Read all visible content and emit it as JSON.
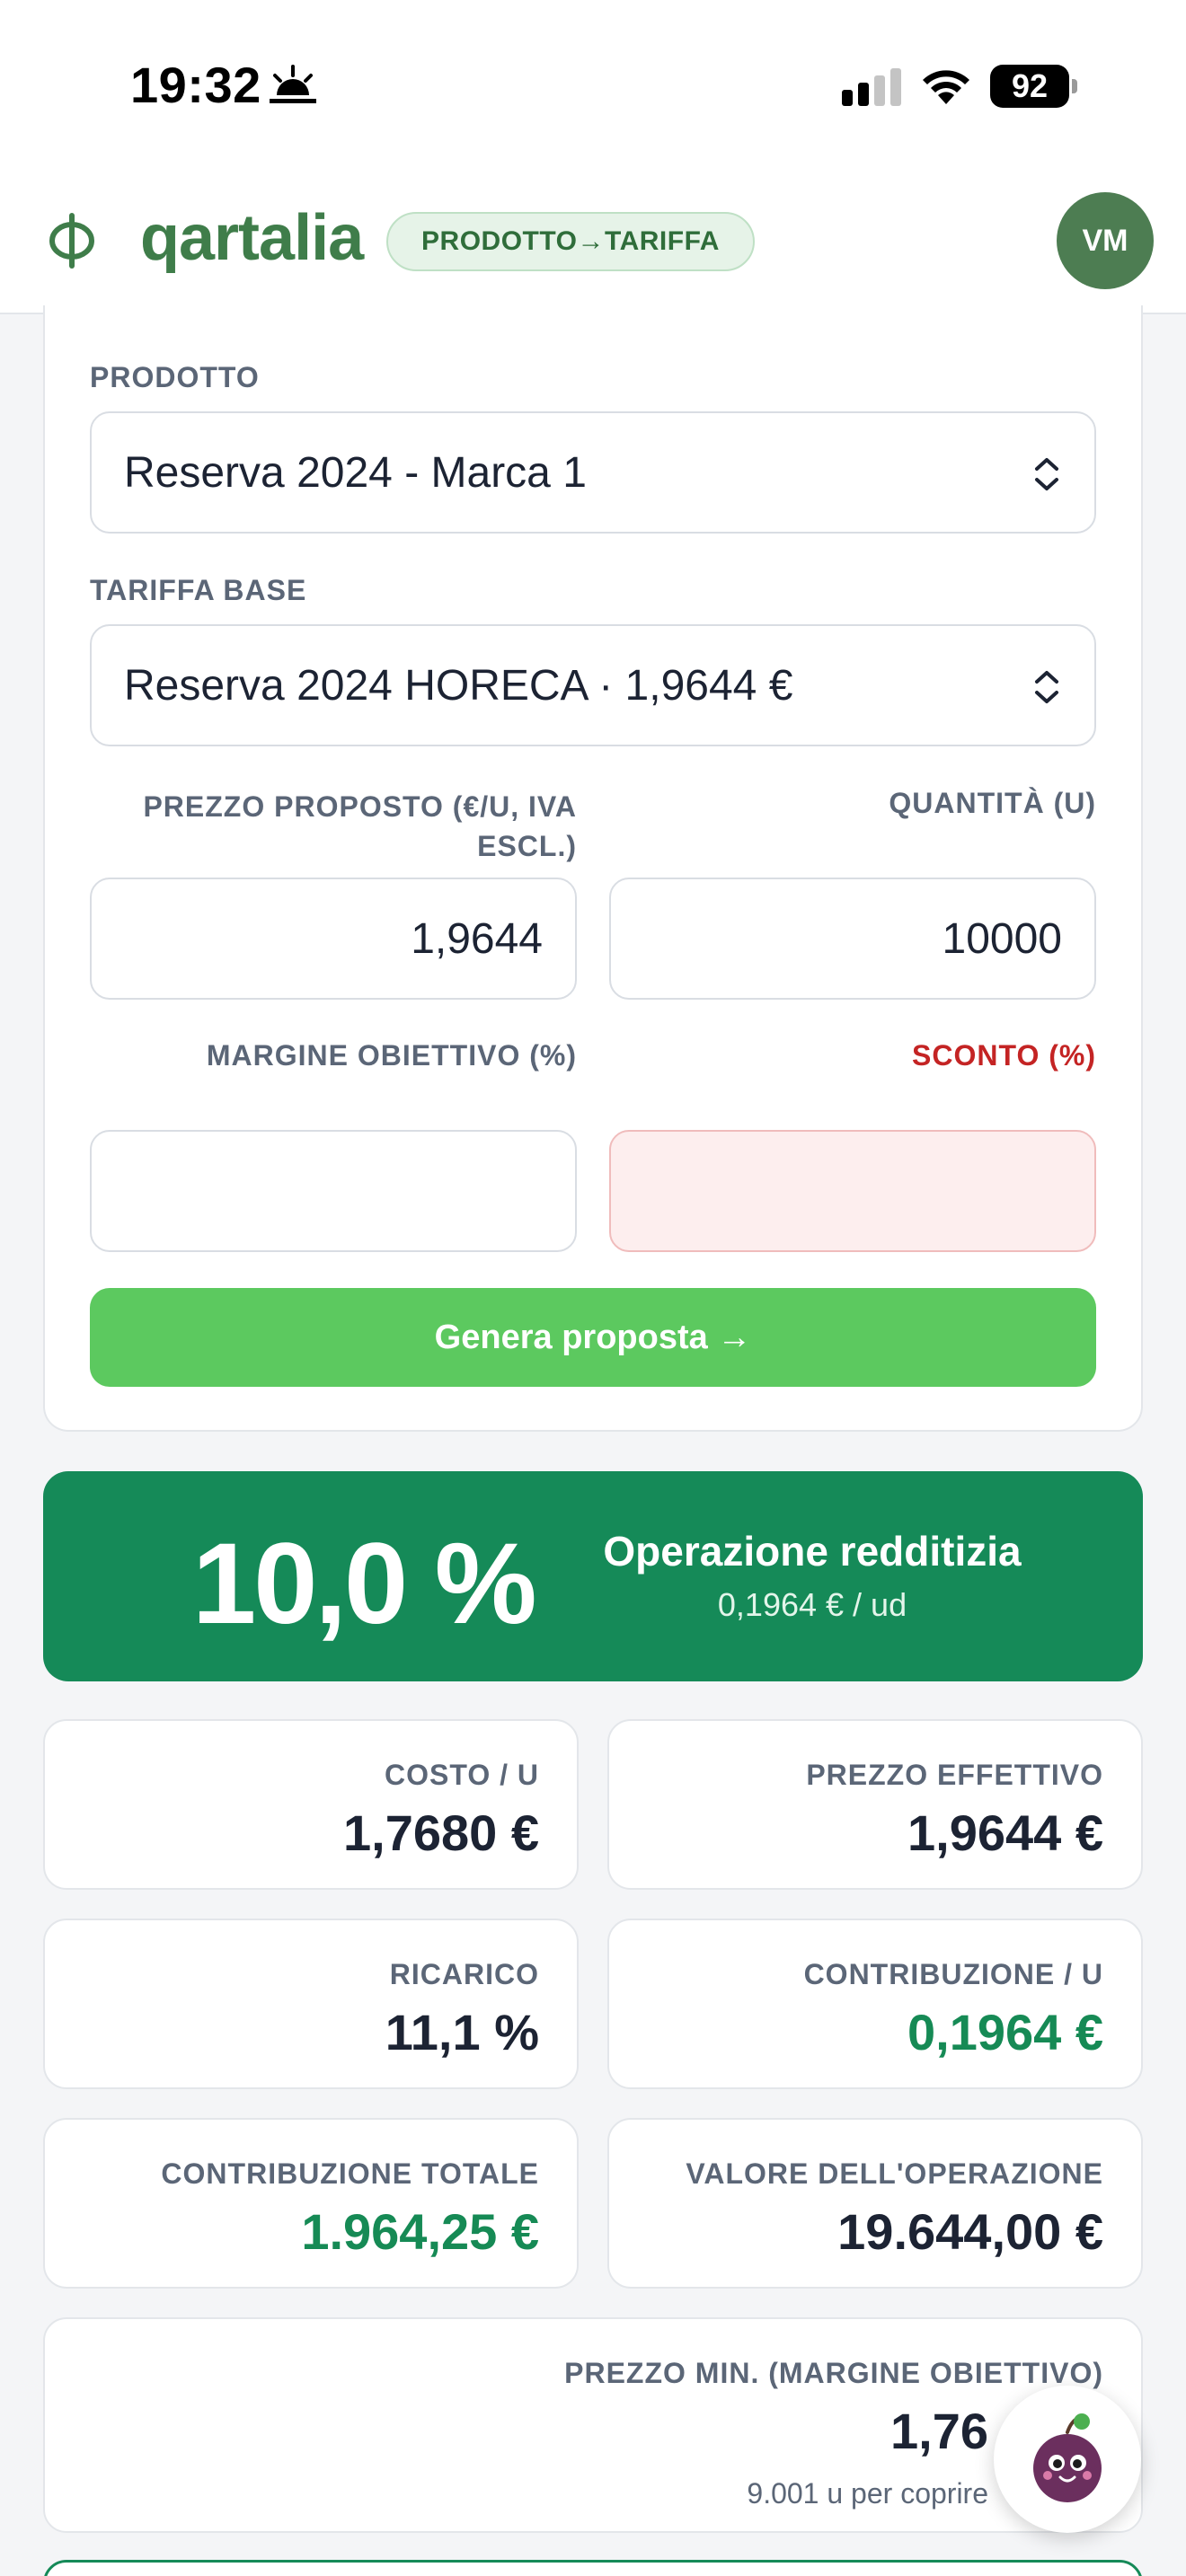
{
  "status_bar": {
    "time": "19:32",
    "battery": "92"
  },
  "header": {
    "brand": "qartalia",
    "mode": "PRODOTTO→TARIFFA",
    "avatar_initials": "VM",
    "brand_color": "#3f7d4a"
  },
  "form": {
    "product_label": "PRODOTTO",
    "product_value": "Reserva 2024 - Marca 1",
    "tariff_label": "TARIFFA BASE",
    "tariff_value": "Reserva 2024 HORECA · 1,9644 €",
    "price_label_line1": "PREZZO PROPOSTO (€/U, IVA",
    "price_label_line2": "ESCL.)",
    "price_value": "1,9644",
    "quantity_label": "QUANTITÀ (U)",
    "quantity_value": "10000",
    "margin_label": "MARGINE OBIETTIVO (%)",
    "margin_value": "",
    "discount_label": "SCONTO (%)",
    "discount_value": "",
    "generate_button": "Genera proposta →"
  },
  "result": {
    "margin_pct": "10,0 %",
    "status": "Operazione redditizia",
    "per_unit": "0,1964 € / ud",
    "color": "#158a58"
  },
  "metrics": [
    {
      "label": "COSTO / U",
      "value": "1,7680 €"
    },
    {
      "label": "PREZZO EFFETTIVO",
      "value": "1,9644 €"
    },
    {
      "label": "RICARICO",
      "value": "11,1 %"
    },
    {
      "label": "CONTRIBUZIONE / U",
      "value": "0,1964 €"
    },
    {
      "label": "CONTRIBUZIONE TOTALE",
      "value": "1.964,25 €"
    },
    {
      "label": "VALORE DELL'OPERAZIONE",
      "value": "19.644,00 €"
    }
  ],
  "min_price": {
    "label": "PREZZO MIN. (MARGINE OBIETTIVO)",
    "value": "1,76",
    "note": "9.001 u per coprire"
  },
  "icons": {
    "logo": "phi-logo-icon",
    "select_chevron": "chevron-up-down-icon",
    "assistant": "grape-mascot-icon"
  }
}
